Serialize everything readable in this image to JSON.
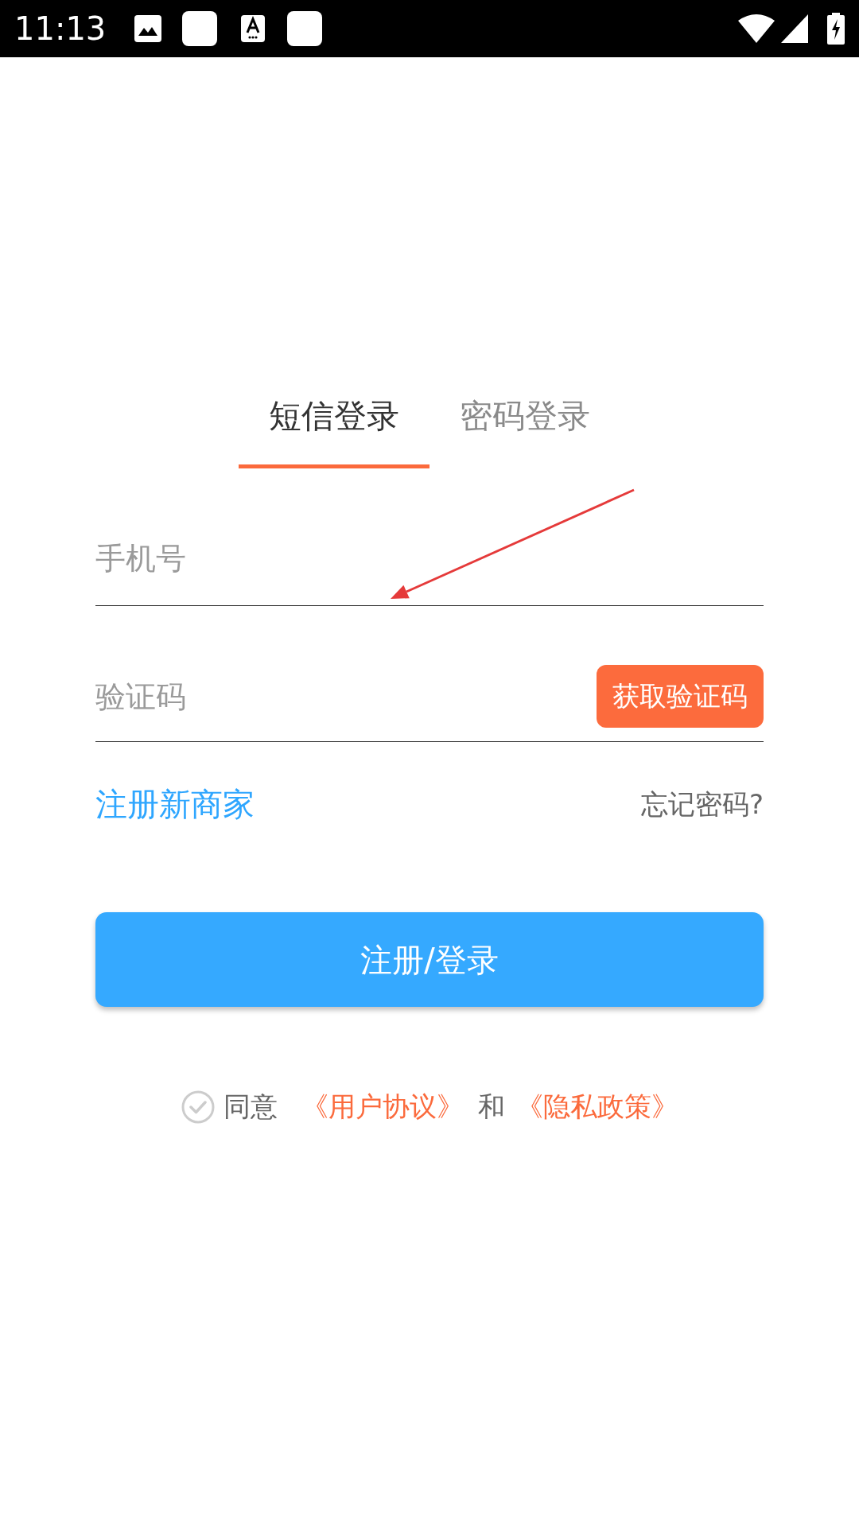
{
  "status_bar": {
    "time": "11:13"
  },
  "tabs": [
    {
      "label": "短信登录",
      "selected": true
    },
    {
      "label": "密码登录",
      "selected": false
    }
  ],
  "phone_field": {
    "placeholder": "手机号"
  },
  "code_field": {
    "placeholder": "验证码",
    "button": "获取验证码"
  },
  "links": {
    "register": "注册新商家",
    "forgot": "忘记密码?"
  },
  "submit_button": "注册/登录",
  "agreement": {
    "checked": false,
    "parts": [
      {
        "kind": "text",
        "text": "同意"
      },
      {
        "kind": "link",
        "text": "《用户协议》"
      },
      {
        "kind": "text",
        "text": "和"
      },
      {
        "kind": "link",
        "text": "《隐私政策》"
      }
    ]
  }
}
